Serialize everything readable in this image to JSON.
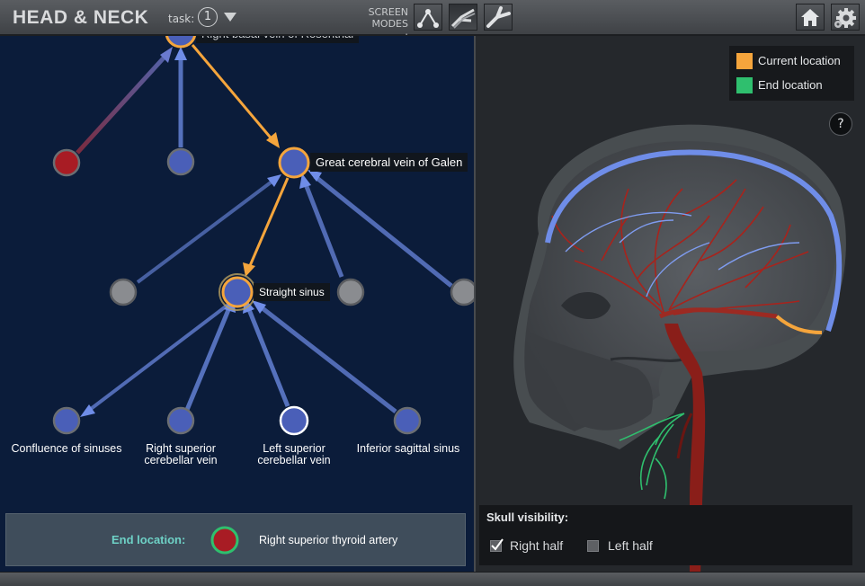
{
  "app": {
    "title": "HEAD & NECK",
    "task_label": "task:",
    "task_number": "1",
    "screen_modes_label": [
      "SCREEN",
      "MODES :"
    ]
  },
  "icons": {
    "mode_1": "graph-mode-icon",
    "mode_2": "vessel-pair-mode-icon",
    "mode_3": "vessel-single-mode-icon",
    "home": "home-icon",
    "settings": "gear-icon",
    "help": "help-icon"
  },
  "graph": {
    "top_partial_label": "Right basal vein of Rosenthal",
    "great_cerebral": "Great cerebral vein of Galen",
    "straight_sinus": "Straight sinus",
    "children": [
      {
        "lines": [
          "Confluence of sinuses"
        ]
      },
      {
        "lines": [
          "Right superior",
          "cerebellar vein"
        ]
      },
      {
        "lines": [
          "Left superior",
          "cerebellar vein"
        ]
      },
      {
        "lines": [
          "Inferior sagittal sinus"
        ]
      }
    ]
  },
  "end_location": {
    "label": "End location:",
    "name": "Right superior thyroid artery"
  },
  "legend": {
    "items": [
      {
        "label": "Current location",
        "color": "#f5a53c"
      },
      {
        "label": "End location",
        "color": "#2fbf6e"
      }
    ]
  },
  "help": {
    "label": "?"
  },
  "skull": {
    "title": "Skull visibility:",
    "options": [
      {
        "label": "Right half",
        "checked": true
      },
      {
        "label": "Left half",
        "checked": false
      }
    ]
  },
  "colors": {
    "graph_bg": "#0b1c3a",
    "node_blue": "#4a5fb8",
    "node_gray": "#8a8c90",
    "node_red": "#a81c24",
    "current_path": "#f5a53c",
    "end_ring": "#2fbf6e",
    "vein": "#6f8de8",
    "artery": "#a8231c"
  }
}
